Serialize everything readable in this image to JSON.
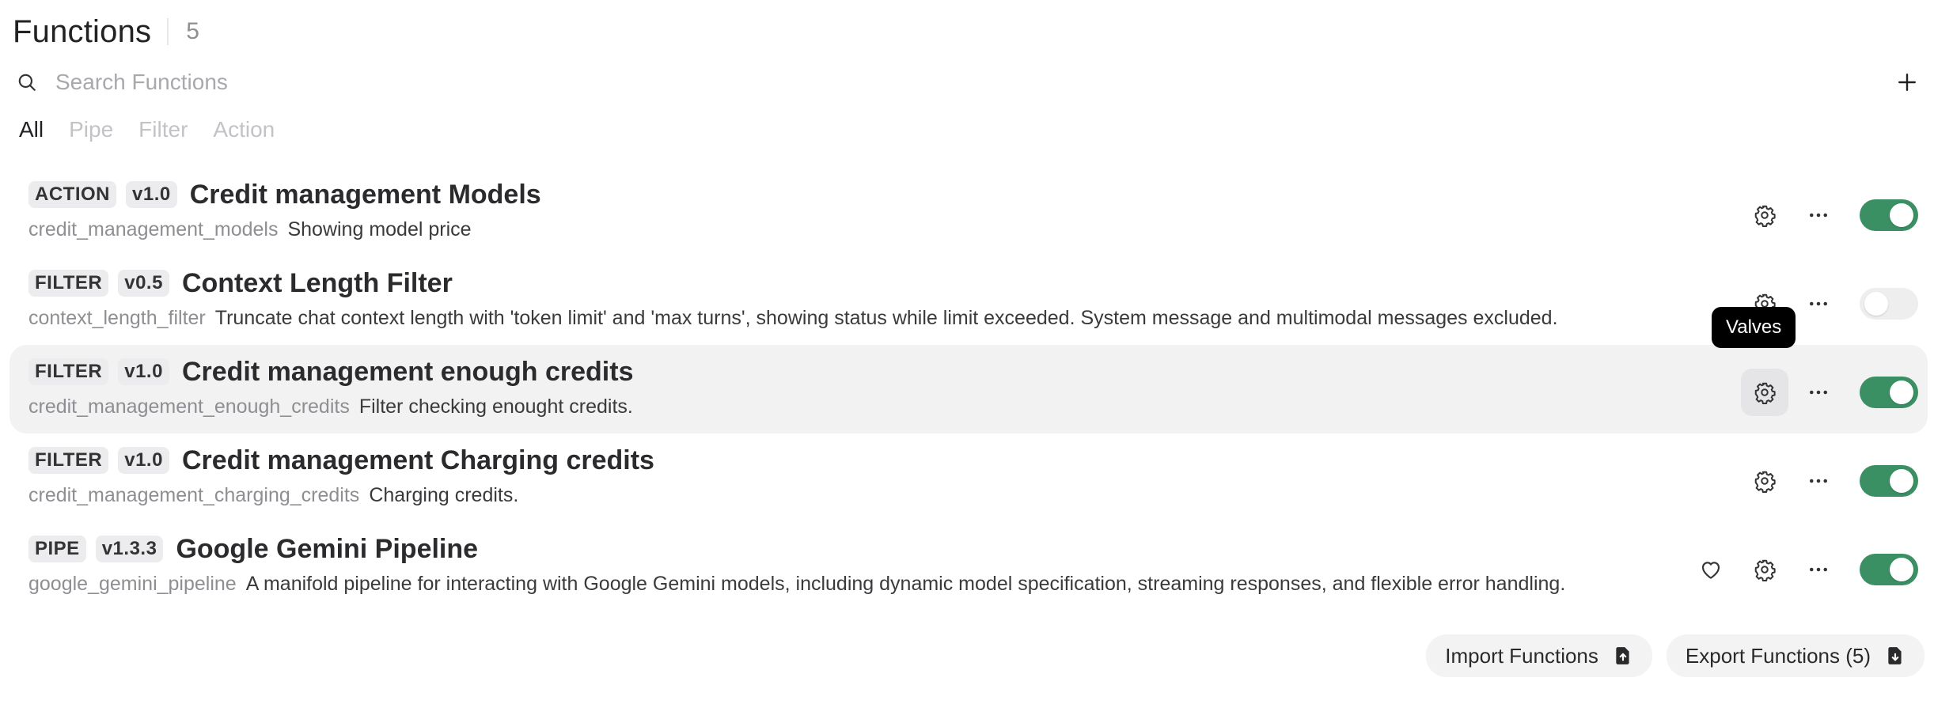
{
  "header": {
    "title": "Functions",
    "count": "5"
  },
  "search": {
    "placeholder": "Search Functions",
    "value": ""
  },
  "tabs": [
    {
      "label": "All",
      "active": true
    },
    {
      "label": "Pipe",
      "active": false
    },
    {
      "label": "Filter",
      "active": false
    },
    {
      "label": "Action",
      "active": false
    }
  ],
  "functions": [
    {
      "type": "ACTION",
      "version": "v1.0",
      "name": "Credit management Models",
      "id": "credit_management_models",
      "description": "Showing model price",
      "enabled": true
    },
    {
      "type": "FILTER",
      "version": "v0.5",
      "name": "Context Length Filter",
      "id": "context_length_filter",
      "description": "Truncate chat context length with 'token limit' and 'max turns', showing status while limit exceeded. System message and multimodal messages excluded.",
      "enabled": false
    },
    {
      "type": "FILTER",
      "version": "v1.0",
      "name": "Credit management enough credits",
      "id": "credit_management_enough_credits",
      "description": "Filter checking enought credits.",
      "enabled": true
    },
    {
      "type": "FILTER",
      "version": "v1.0",
      "name": "Credit management Charging credits",
      "id": "credit_management_charging_credits",
      "description": "Charging credits.",
      "enabled": true
    },
    {
      "type": "PIPE",
      "version": "v1.3.3",
      "name": "Google Gemini Pipeline",
      "id": "google_gemini_pipeline",
      "description": "A manifold pipeline for interacting with Google Gemini models, including dynamic model specification, streaming responses, and flexible error handling.",
      "enabled": true
    }
  ],
  "tooltip": {
    "text": "Valves"
  },
  "footer": {
    "import_label": "Import Functions",
    "export_label": "Export Functions (5)"
  },
  "colors": {
    "toggle_on": "#3a8f63",
    "toggle_off": "#eeeeef",
    "row_hover": "#f2f2f3"
  },
  "icons": [
    "search-icon",
    "plus-icon",
    "gear-icon",
    "more-horizontal-icon",
    "heart-icon",
    "upload-file-icon",
    "download-file-icon"
  ]
}
